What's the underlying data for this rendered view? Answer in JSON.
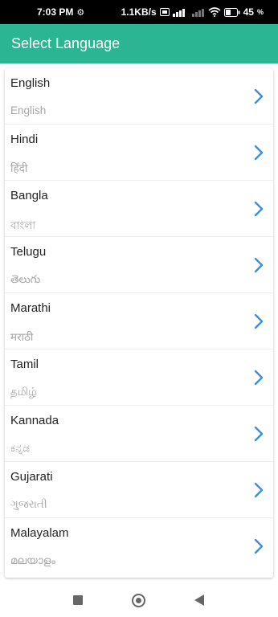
{
  "status_bar": {
    "time": "7:03 PM",
    "speed": "1.1KB/s",
    "battery": "45"
  },
  "app_bar": {
    "title": "Select Language"
  },
  "languages": [
    {
      "name": "English",
      "native": "English"
    },
    {
      "name": "Hindi",
      "native": "हिंदी"
    },
    {
      "name": "Bangla",
      "native": "বাংলা"
    },
    {
      "name": "Telugu",
      "native": "తెలుగు"
    },
    {
      "name": "Marathi",
      "native": "मराठी"
    },
    {
      "name": "Tamil",
      "native": "தமிழ்"
    },
    {
      "name": "Kannada",
      "native": "ಕನ್ನಡ"
    },
    {
      "name": "Gujarati",
      "native": "ગુજરાતી"
    },
    {
      "name": "Malayalam",
      "native": "മലയാളം"
    }
  ],
  "colors": {
    "accent": "#2bb592",
    "chevron": "#3d8fd9"
  },
  "icons": {
    "row_chevron": "chevron-right-icon",
    "status_settings": "gear-icon"
  }
}
